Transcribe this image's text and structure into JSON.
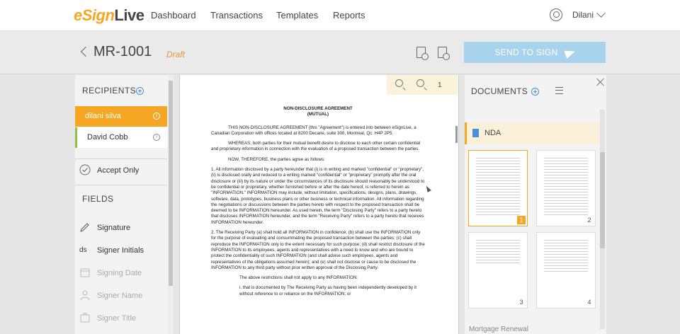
{
  "app": {
    "logo_e": "e",
    "logo_sign": "Sign",
    "logo_live": "Live"
  },
  "nav": {
    "items": [
      "Dashboard",
      "Transactions",
      "Templates",
      "Reports"
    ]
  },
  "user": {
    "name": "Dilani"
  },
  "transaction": {
    "title": "MR-1001",
    "status": "Draft",
    "send_label": "SEND TO SIGN"
  },
  "recipients": {
    "title": "RECIPIENTS",
    "items": [
      {
        "name": "dilani silva",
        "active": true
      },
      {
        "name": "David Cobb",
        "active": false
      }
    ],
    "accept_only": "Accept Only"
  },
  "fields": {
    "title": "FIELDS",
    "items": [
      {
        "label": "Signature",
        "icon": "pen-icon",
        "enabled": true
      },
      {
        "label": "Signer Initials",
        "icon": "initials-icon",
        "prefix": "ds",
        "enabled": true
      },
      {
        "label": "Signing Date",
        "icon": "calendar-icon",
        "enabled": false
      },
      {
        "label": "Signer Name",
        "icon": "person-icon",
        "enabled": false
      },
      {
        "label": "Signer Title",
        "icon": "title-icon",
        "enabled": false
      }
    ]
  },
  "viewer": {
    "page": "1",
    "doc_title": "NON-DISCLOSURE AGREEMENT",
    "doc_subtitle": "(MUTUAL)",
    "paragraphs": [
      "THIS NON-DISCLOSURE AGREEMENT (this \"Agreement\") is entered into between eSignLive, a Canadian Corporation with offices located at 8200 Decarie, suite 300, Montreal, Qc. H4P 2P5.",
      "WHEREAS, both parties for their mutual benefit desire to disclose to each other certain confidential and proprietary information in connection with the evaluation of a proposed transaction between the parties.",
      "NOW, THEREFORE, the parties agree as follows:",
      "1.       All information disclosed by a party hereunder that (i) is in writing and marked \"confidential\" or \"proprietary\", (ii) is disclosed orally and reduced to a writing marked \"confidential\" or \"proprietary\" promptly after the oral disclosure or (iii) by its nature or under the circumstances of its disclosure should reasonably be understood to be confidential or proprietary, whether furnished before or after the date hereof, is referred to herein as \"INFORMATION.\" INFORMATION may include, without limitation, specifications, designs, plans, drawings, software, data, prototypes, business plans or other business or technical information. All information regarding the negotiations or discussions between the parties hereto with respect to the proposed transaction shall be deemed to be INFORMATION hereunder. As used herein, the term \"Disclosing Party\" refers to a party hereto that discloses INFORMATION hereunder, and the term \"Receiving Party\" refers to a party hereto that receives INFORMATION hereunder.",
      "2.       The Receiving Party (a) shall hold all INFORMATION in confidence; (b) shall use the INFORMATION only for the purpose of evaluating and consummating the proposed transaction between the parties; (c) shall reproduce the INFORMATION only to the extent necessary for such purpose; (d) shall restrict disclosure of the INFORMATION to its employees, agents and representatives with a need to know and who are bound to protect the confidentiality of such INFORMATION (and shall advise such employees, agents and representatives of the obligations assumed herein); and (e) shall not disclose or cause to be disclosed the INFORMATION to any third party without prior written approval of the Disclosing Party.",
      "The above restrictions shall not apply to any INFORMATION:",
      "i.       that is documented by The Receiving Party as having been independently developed by it without reference to or reliance on the INFORMATION; or"
    ]
  },
  "documents": {
    "title": "DOCUMENTS",
    "current": "NDA",
    "pages": [
      "1",
      "2",
      "3",
      "4"
    ],
    "next": "Mortgage Renewal"
  }
}
